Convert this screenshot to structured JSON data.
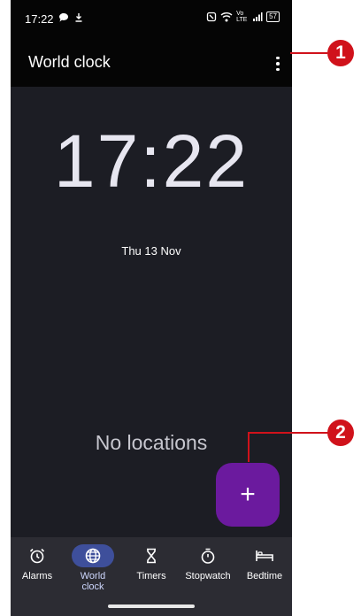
{
  "status_bar": {
    "time": "17:22",
    "left_icons": [
      "chat-bubble-icon",
      "download-icon"
    ],
    "right_icons": [
      "nfc-icon",
      "wifi-icon",
      "volte-icon",
      "signal-icon"
    ],
    "volte_label": "Vo LTE",
    "battery": "57"
  },
  "app_bar": {
    "title": "World clock",
    "menu_icon": "more-vert-icon"
  },
  "clock": {
    "time": "17:22",
    "date": "Thu 13 Nov"
  },
  "empty_state": "No locations",
  "fab": {
    "icon": "plus-icon",
    "label": "+"
  },
  "nav": [
    {
      "label": "Alarms",
      "icon": "alarm-clock-icon",
      "active": false
    },
    {
      "label": "World clock",
      "icon": "globe-icon",
      "active": true
    },
    {
      "label": "Timers",
      "icon": "hourglass-icon",
      "active": false
    },
    {
      "label": "Stopwatch",
      "icon": "stopwatch-icon",
      "active": false
    },
    {
      "label": "Bedtime",
      "icon": "bed-icon",
      "active": false
    }
  ],
  "callouts": [
    "1",
    "2"
  ],
  "colors": {
    "background": "#1c1d24",
    "fab": "#6b1a9e",
    "nav_active": "#3e4f9b",
    "callout": "#d0121b"
  }
}
